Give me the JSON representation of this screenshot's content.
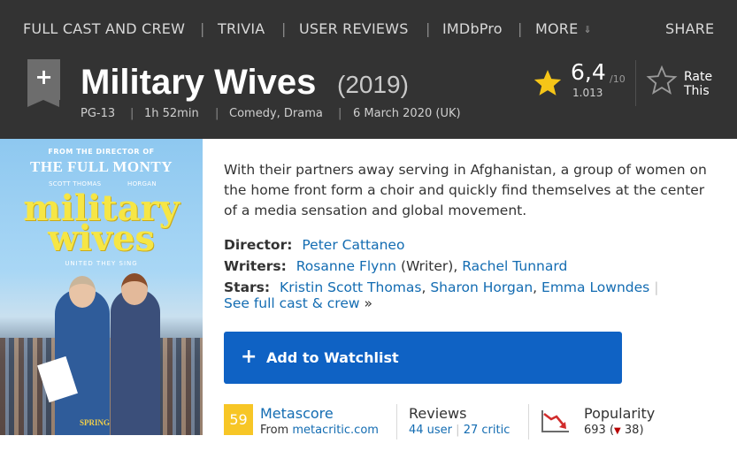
{
  "subnav": {
    "items": [
      "FULL CAST AND CREW",
      "TRIVIA",
      "USER REVIEWS",
      "IMDbPro",
      "MORE"
    ],
    "share": "SHARE"
  },
  "movie": {
    "title": "Military Wives",
    "year": "(2019)",
    "certificate": "PG-13",
    "runtime": "1h 52min",
    "genres": "Comedy, Drama",
    "release": "6 March 2020 (UK)"
  },
  "rating": {
    "value": "6,4",
    "max": "/10",
    "count": "1.013",
    "rate_label": "Rate This",
    "star_color": "#f5c518"
  },
  "poster": {
    "from_line": "FROM THE DIRECTOR OF",
    "prior_film": "THE FULL MONTY",
    "actor_left": "SCOTT THOMAS",
    "actor_right": "HORGAN",
    "title_line1": "military",
    "title_line2": "wives",
    "tagline": "UNITED THEY SING",
    "season": "SPRING"
  },
  "plot": "With their partners away serving in Afghanistan, a group of women on the home front form a choir and quickly find themselves at the center of a media sensation and global movement.",
  "credits": {
    "director_label": "Director:",
    "director": "Peter Cattaneo",
    "writers_label": "Writers:",
    "writer1": "Rosanne Flynn",
    "writer1_role": "(Writer),",
    "writer2": "Rachel Tunnard",
    "stars_label": "Stars:",
    "star1": "Kristin Scott Thomas",
    "star2": "Sharon Horgan",
    "star3": "Emma Lowndes",
    "see_full": "See full cast & crew",
    "see_full_arrow": "»"
  },
  "watchlist": {
    "label": "Add to Watchlist",
    "color": "#0f62c4"
  },
  "reviews_bar": {
    "metascore": "59",
    "metascore_label": "Metascore",
    "from_text": "From",
    "metacritic_link": "metacritic.com",
    "reviews_label": "Reviews",
    "user_reviews": "44 user",
    "critic_reviews": "27 critic",
    "popularity_label": "Popularity",
    "popularity_value": "693",
    "popularity_change": "38",
    "change_color": "#b80000"
  }
}
